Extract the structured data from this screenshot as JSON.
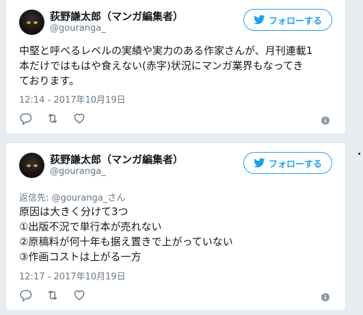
{
  "tweets": [
    {
      "author": {
        "name": "荻野謙太郎（マンガ編集者）",
        "handle": "@gouranga_"
      },
      "follow_label": "フォローする",
      "reply_to": null,
      "lines": [
        "中堅と呼べるレベルの実績や実力のある作家さんが、月刊連載1",
        "本だけではもはや食えない(赤字)状況にマンガ業界もなってき",
        "ております。"
      ],
      "timestamp": "12:14 - 2017年10月19日",
      "actions": [
        "reply-icon",
        "retweet-icon",
        "like-icon",
        "info-icon"
      ]
    },
    {
      "author": {
        "name": "荻野謙太郎（マンガ編集者）",
        "handle": "@gouranga_"
      },
      "follow_label": "フォローする",
      "reply_to": "返信先: @gouranga_さん",
      "lines": [
        "原因は大きく分けて3つ",
        "①出版不況で単行本が売れない",
        "②原稿料が何十年も据え置きで上がっていない",
        "③作画コストは上がる一方"
      ],
      "timestamp": "12:17 - 2017年10月19日",
      "actions": [
        "reply-icon",
        "retweet-icon",
        "like-icon",
        "info-icon"
      ]
    }
  ],
  "colors": {
    "background": "#e6ecf0",
    "accent": "#1da1f2",
    "secondary_text": "#657786",
    "primary_text": "#14171a"
  }
}
